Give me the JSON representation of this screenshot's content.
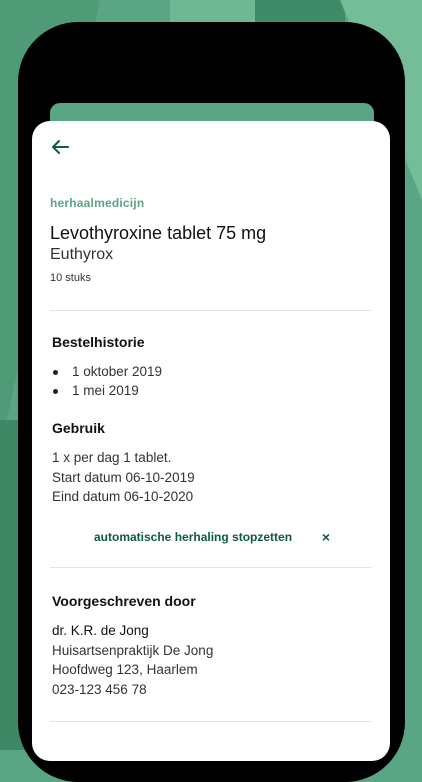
{
  "header": {
    "back_icon": "arrow-left-icon",
    "category": "herhaalmedicijn"
  },
  "medication": {
    "name": "Levothyroxine tablet 75 mg",
    "brand": "Euthyrox",
    "quantity": "10 stuks"
  },
  "order_history": {
    "title": "Bestelhistorie",
    "items": [
      "1 oktober 2019",
      "1 mei 2019"
    ]
  },
  "usage": {
    "title": "Gebruik",
    "dosage": "1 x per dag 1 tablet.",
    "start": "Start datum 06-10-2019",
    "end": "Eind datum 06-10-2020"
  },
  "repeat": {
    "stop_label": "automatische herhaling stopzetten",
    "close_icon": "close-icon",
    "close_glyph": "×"
  },
  "prescriber": {
    "title": "Voorgeschreven door",
    "name": "dr. K.R. de Jong",
    "practice": "Huisartsenpraktijk De Jong",
    "address": "Hoofdweg 123, Haarlem",
    "phone": "023-123 456 78"
  },
  "colors": {
    "brand_green": "#5aa583",
    "dark_green": "#0e5a45"
  }
}
